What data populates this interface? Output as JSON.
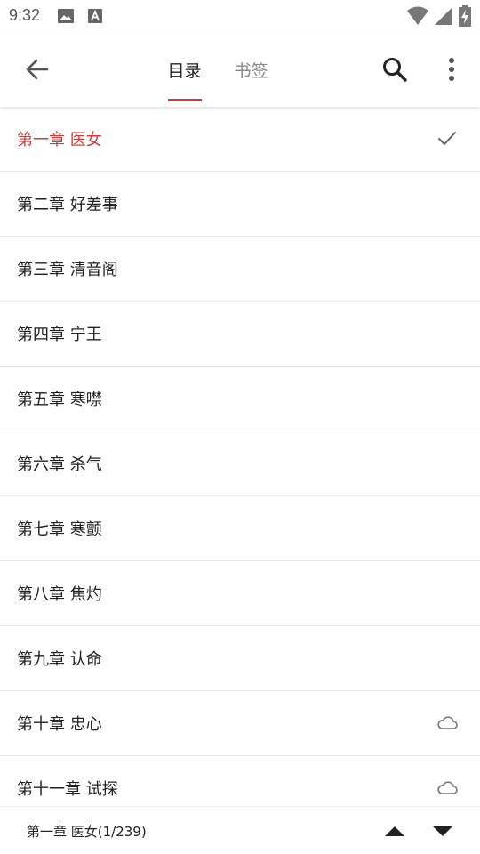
{
  "status_bar": {
    "time": "9:32",
    "icons": [
      "image-icon",
      "font-a-icon",
      "wifi-icon",
      "signal-icon",
      "battery-charging-icon"
    ]
  },
  "app_bar": {
    "back_icon": "arrow-left-icon",
    "tabs": [
      {
        "label": "目录",
        "active": true
      },
      {
        "label": "书签",
        "active": false
      }
    ],
    "search_icon": "search-icon",
    "more_icon": "more-vertical-icon"
  },
  "chapters": [
    {
      "title": "第一章 医女",
      "status": "current"
    },
    {
      "title": "第二章 好差事",
      "status": ""
    },
    {
      "title": "第三章 清音阁",
      "status": ""
    },
    {
      "title": "第四章 宁王",
      "status": ""
    },
    {
      "title": "第五章 寒噤",
      "status": ""
    },
    {
      "title": "第六章 杀气",
      "status": ""
    },
    {
      "title": "第七章 寒颤",
      "status": ""
    },
    {
      "title": "第八章 焦灼",
      "status": ""
    },
    {
      "title": "第九章 认命",
      "status": ""
    },
    {
      "title": "第十章 忠心",
      "status": "cloud"
    },
    {
      "title": "第十一章 试探",
      "status": "cloud"
    }
  ],
  "bottom_bar": {
    "current_chapter": "第一章 医女(1/239)",
    "prev_icon": "triangle-up-icon",
    "next_icon": "triangle-down-icon"
  },
  "colors": {
    "accent": "#d23b3b",
    "text": "#222222",
    "muted": "#888888",
    "divider": "#e8e8e8"
  }
}
